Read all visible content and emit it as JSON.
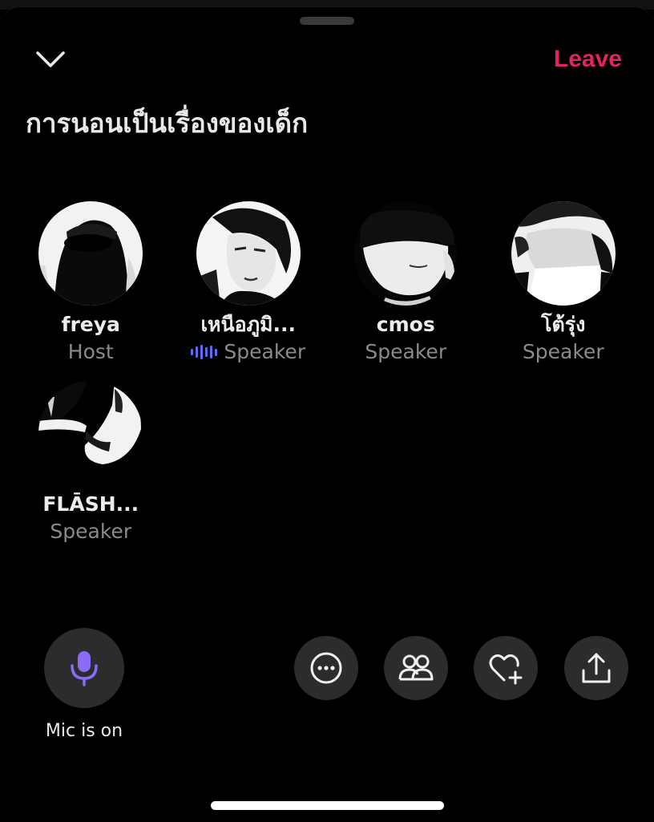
{
  "header": {
    "collapse_icon": "chevron-down-icon",
    "leave_label": "Leave",
    "leave_color": "#e0245e"
  },
  "room": {
    "title": "การนอนเป็นเรื่องของเด็ก"
  },
  "participants": [
    {
      "name": "freya",
      "role": "Host",
      "speaking": false
    },
    {
      "name": "เหนือภูมิ...",
      "role": "Speaker",
      "speaking": true
    },
    {
      "name": "cmos",
      "role": "Speaker",
      "speaking": false
    },
    {
      "name": "โต้รุ่ง",
      "role": "Speaker",
      "speaking": false
    },
    {
      "name": "FLĀSH...",
      "role": "Speaker",
      "speaking": false
    }
  ],
  "controls": {
    "mic_label": "Mic is on",
    "mic_icon": "microphone-icon",
    "mic_color": "#8b6cf6",
    "buttons": [
      {
        "icon": "more-icon"
      },
      {
        "icon": "people-icon"
      },
      {
        "icon": "heart-plus-icon"
      },
      {
        "icon": "share-icon"
      }
    ]
  },
  "colors": {
    "background": "#000000",
    "button_bg": "#2c2c2e",
    "speaking_indicator": "#5b6cf0"
  }
}
